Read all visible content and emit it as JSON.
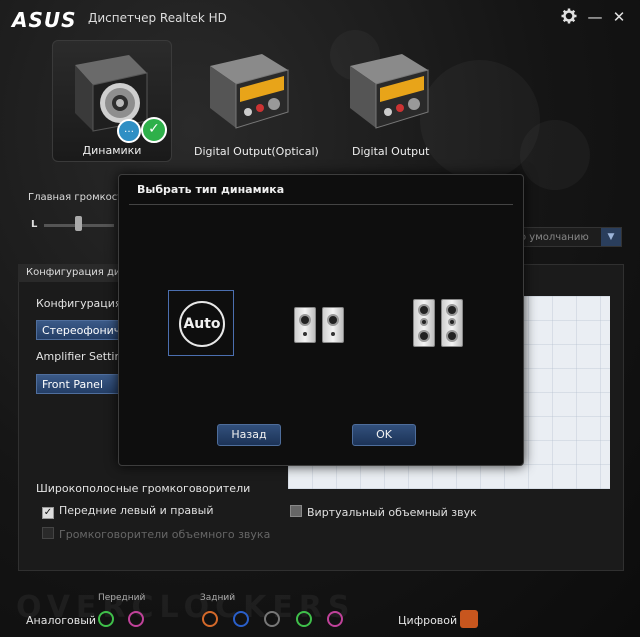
{
  "window": {
    "brand": "ASUS",
    "title": "Диспетчер Realtek HD",
    "buttons": {
      "settings_icon": "gear-icon",
      "minimize": "—",
      "close": "✕"
    }
  },
  "devices": [
    {
      "label": "Динамики",
      "active": true
    },
    {
      "label": "Digital Output(Optical)",
      "active": false
    },
    {
      "label": "Digital Output",
      "active": false
    }
  ],
  "volume": {
    "label": "Главная громкость",
    "left_label": "L"
  },
  "default_dropdown": {
    "text": "о умолчанию"
  },
  "config_panel": {
    "tab_label": "Конфигурация дин",
    "config_label": "Конфигурация д",
    "config_value": "Стереофониче",
    "amp_label": "Amplifier Setting",
    "amp_value": "Front Panel"
  },
  "wideband": {
    "title": "Широкополосные громкоговорители",
    "front": {
      "label": "Передние левый и правый",
      "checked": true
    },
    "surround": {
      "label": "Громкоговорители объемного звука",
      "checked": false,
      "enabled": false
    }
  },
  "virtual_surround": {
    "label": "Виртуальный объемный звук",
    "checked": false
  },
  "jacks": {
    "front_label": "Передний",
    "rear_label": "Задний",
    "analog_label": "Аналоговый",
    "digital_label": "Цифровой",
    "colors": {
      "front": [
        "#3fbf4a",
        "#c0429a"
      ],
      "rear": [
        "#d4692a",
        "#2a5fc9",
        "#777777",
        "#3fbf4a",
        "#c0429a"
      ]
    }
  },
  "modal": {
    "title": "Выбрать тип динамика",
    "auto_label": "Auto",
    "back_button": "Назад",
    "ok_button": "OK"
  },
  "colors": {
    "accent": "#4b6fb0",
    "check_green": "#2eb04a",
    "chat_blue": "#2f8fc4"
  }
}
